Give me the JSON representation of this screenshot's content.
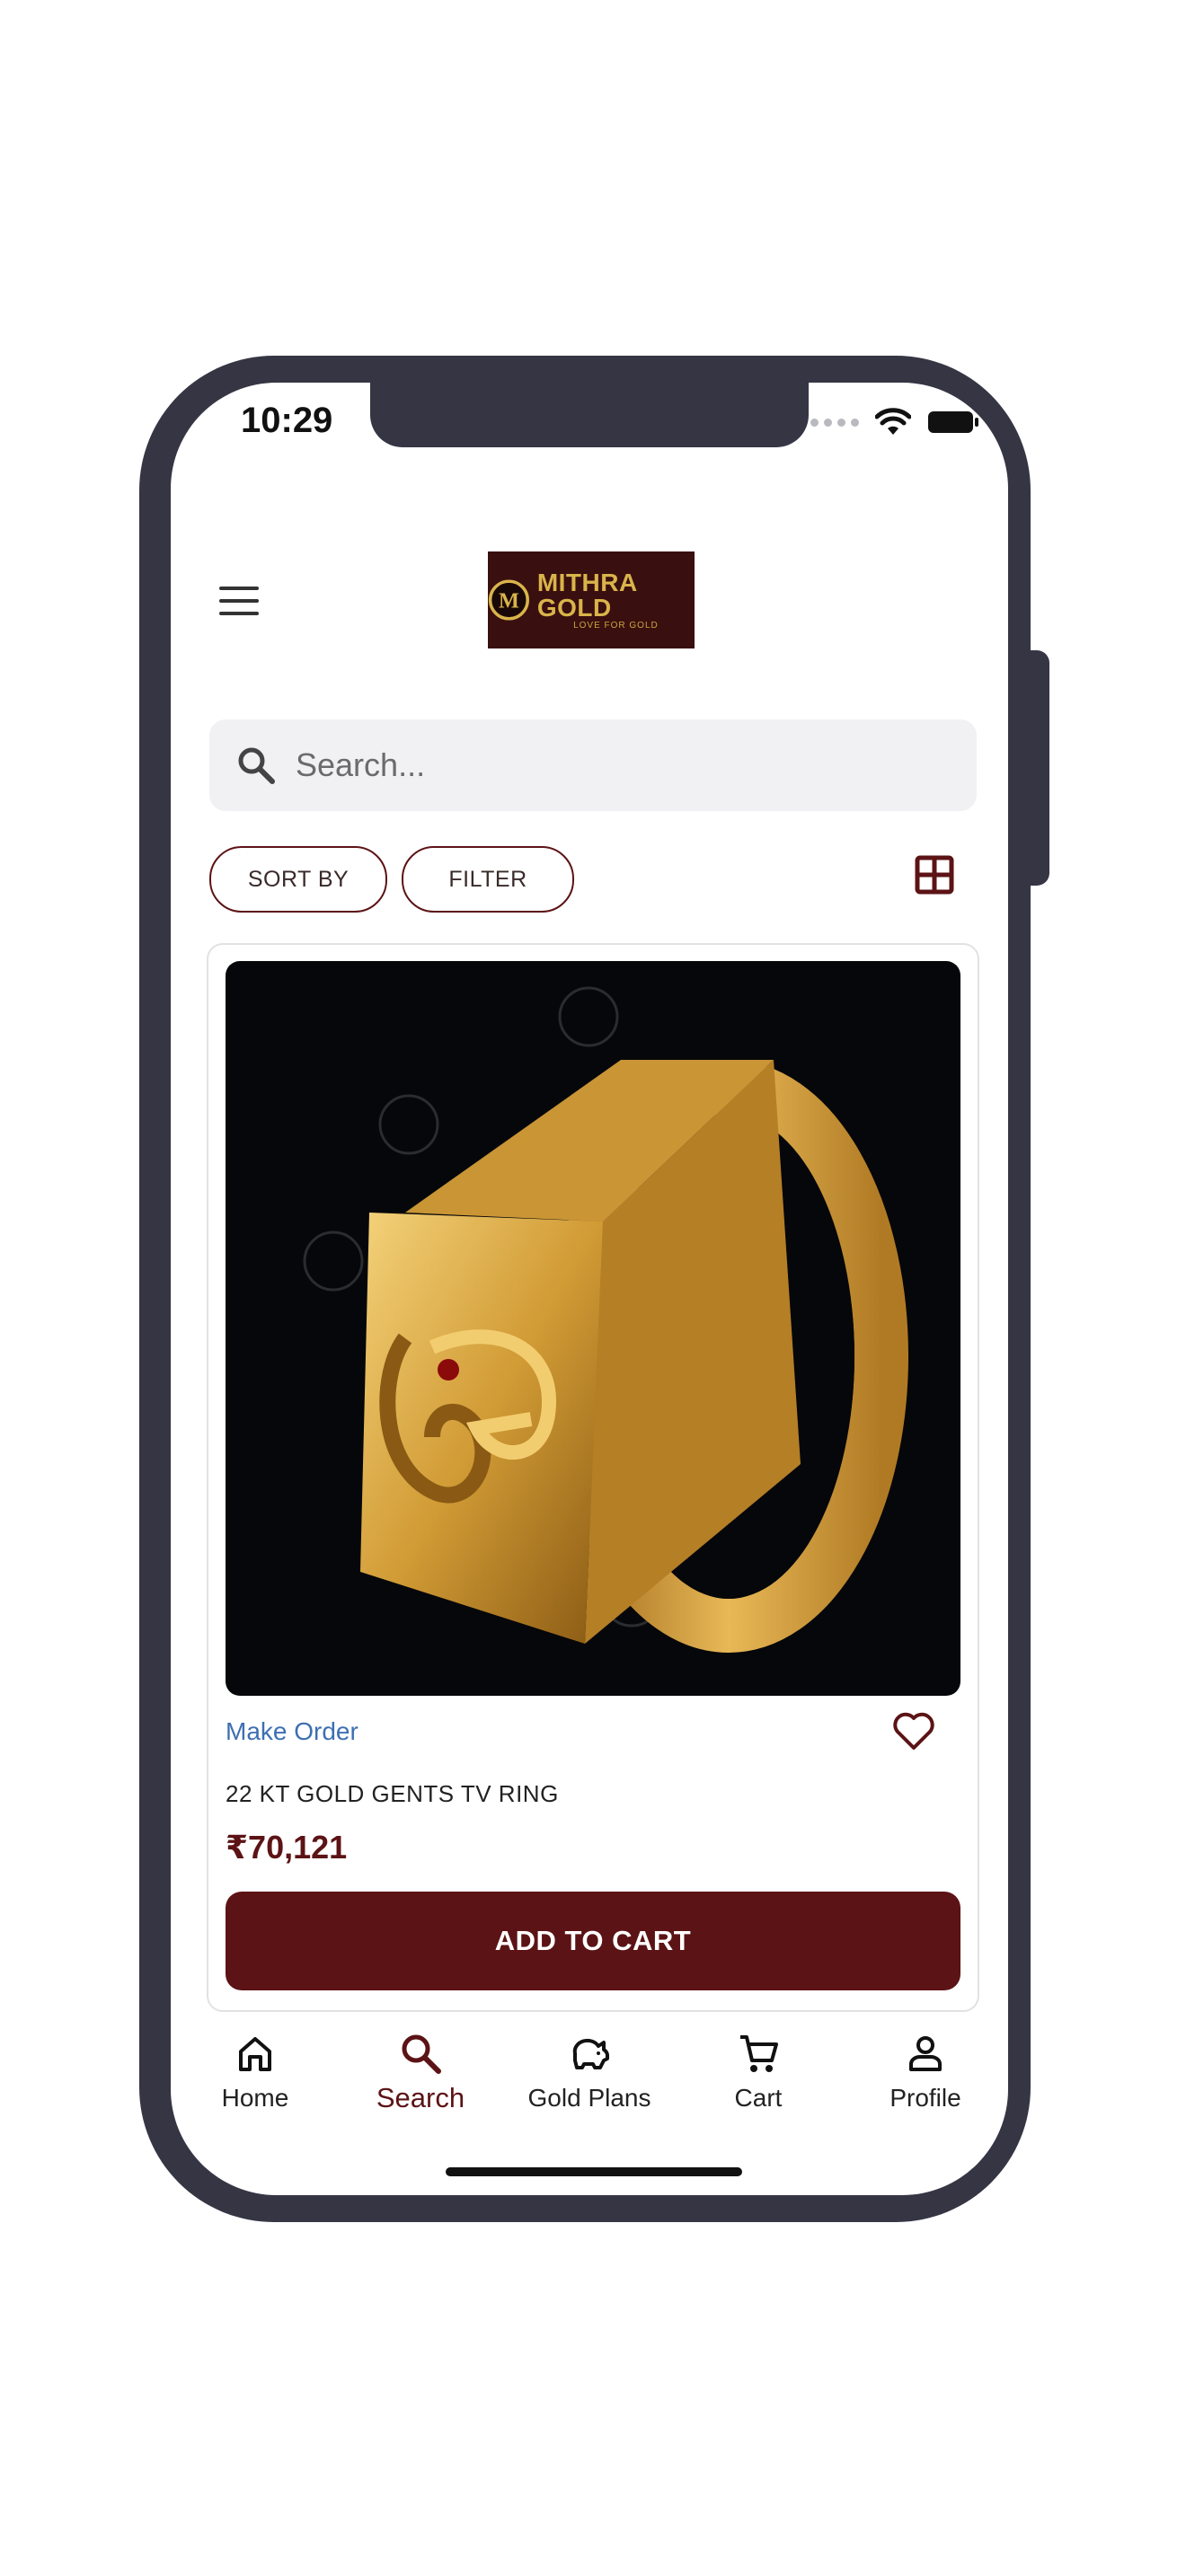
{
  "status_bar": {
    "time": "10:29"
  },
  "header": {
    "logo_main": "MITHRA GOLD",
    "logo_sub": "LOVE FOR GOLD",
    "logo_mark": "M"
  },
  "search": {
    "placeholder": "Search..."
  },
  "filters": {
    "sort_label": "SORT BY",
    "filter_label": "FILTER"
  },
  "product": {
    "order_link": "Make Order",
    "name": "22 KT GOLD GENTS TV RING",
    "price": "₹70,121",
    "add_to_cart": "ADD TO CART"
  },
  "bottom_nav": {
    "items": [
      {
        "label": "Home",
        "icon": "home-icon"
      },
      {
        "label": "Search",
        "icon": "search-icon"
      },
      {
        "label": "Gold Plans",
        "icon": "piggy-bank-icon"
      },
      {
        "label": "Cart",
        "icon": "cart-icon"
      },
      {
        "label": "Profile",
        "icon": "profile-icon"
      }
    ],
    "active": "Search"
  },
  "colors": {
    "brand": "#5c1315",
    "link": "#3d6fb3",
    "phone_frame": "#353544",
    "logo_gold": "#d9b44a"
  }
}
